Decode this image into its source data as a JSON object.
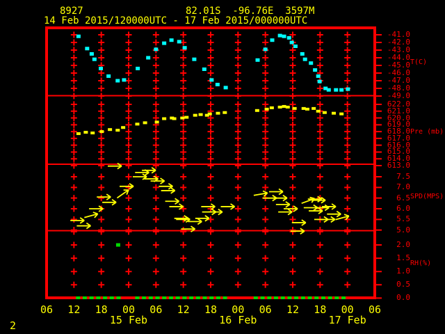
{
  "header": {
    "station_id": "8927",
    "location": "82.01S  -96.76E  3597M",
    "period": "14 Feb 2015/120000UTC - 17 Feb 2015/000000UTC"
  },
  "footer": {
    "page_number": "2"
  },
  "colors": {
    "background": "#000000",
    "grid": "#ff0000",
    "header_text": "#ffff00",
    "temperature": "#00ffff",
    "pressure": "#ffff00",
    "wind": "#ffff00",
    "humidity": "#00d900"
  },
  "chart_data": {
    "type": "scatter",
    "subtype": "multi-panel meteogram",
    "x_axis": {
      "tick_labels": [
        "06",
        "12",
        "18",
        "00",
        "06",
        "12",
        "18",
        "00",
        "06",
        "12",
        "18",
        "00",
        "06"
      ],
      "tick_hours": [
        0,
        6,
        12,
        18,
        24,
        30,
        36,
        42,
        48,
        54,
        60,
        66,
        72
      ],
      "hours_range": [
        0,
        72
      ],
      "date_labels": [
        {
          "label": "15 Feb",
          "hour": 18
        },
        {
          "label": "16 Feb",
          "hour": 42
        },
        {
          "label": "17 Feb",
          "hour": 66
        }
      ]
    },
    "panels": [
      {
        "name": "temperature",
        "ylabel": "T(C)",
        "yticks": [
          "-41.0",
          "-42.0",
          "-43.0",
          "-44.0",
          "-45.0",
          "-46.0",
          "-47.0",
          "-48.0",
          "-49.0"
        ],
        "ylim": [
          -49.0,
          -41.0
        ],
        "grid_rows": [
          -41,
          -42,
          -43,
          -44,
          -45,
          -46,
          -47,
          -48,
          -49
        ],
        "marker_color": "#00ffff",
        "points": [
          [
            7.0,
            -41.2
          ],
          [
            8.9,
            -42.8
          ],
          [
            9.9,
            -43.5
          ],
          [
            10.5,
            -44.2
          ],
          [
            11.9,
            -45.4
          ],
          [
            13.6,
            -46.4
          ],
          [
            15.6,
            -47.0
          ],
          [
            17.0,
            -46.9
          ],
          [
            20.0,
            -45.4
          ],
          [
            22.3,
            -44.0
          ],
          [
            24.0,
            -42.9
          ],
          [
            25.8,
            -42.1
          ],
          [
            27.4,
            -41.7
          ],
          [
            29.1,
            -41.9
          ],
          [
            30.3,
            -42.7
          ],
          [
            32.4,
            -44.2
          ],
          [
            34.6,
            -45.5
          ],
          [
            36.2,
            -46.9
          ],
          [
            37.5,
            -47.5
          ],
          [
            39.3,
            -47.9
          ],
          [
            46.3,
            -44.3
          ],
          [
            48.0,
            -42.9
          ],
          [
            49.5,
            -41.7
          ],
          [
            51.2,
            -41.1
          ],
          [
            52.1,
            -41.2
          ],
          [
            53.2,
            -41.4
          ],
          [
            53.8,
            -42.0
          ],
          [
            54.6,
            -42.5
          ],
          [
            56.1,
            -43.5
          ],
          [
            56.7,
            -44.2
          ],
          [
            58.0,
            -44.7
          ],
          [
            58.9,
            -45.6
          ],
          [
            59.6,
            -46.4
          ],
          [
            59.9,
            -47.1
          ],
          [
            61.2,
            -48.0
          ],
          [
            61.9,
            -48.2
          ],
          [
            63.5,
            -48.2
          ],
          [
            64.7,
            -48.2
          ],
          [
            66.1,
            -48.1
          ]
        ]
      },
      {
        "name": "pressure",
        "ylabel": "Pre (mb)",
        "yticks": [
          "622.0",
          "621.0",
          "620.0",
          "619.0",
          "618.0",
          "617.0",
          "616.0",
          "615.0",
          "614.0",
          "613.0"
        ],
        "ylim": [
          613.0,
          622.0
        ],
        "grid_rows": [
          622,
          621,
          620,
          619,
          618,
          617,
          616,
          615,
          614,
          613
        ],
        "marker_color": "#ffff00",
        "points": [
          [
            7.0,
            617.7
          ],
          [
            8.6,
            617.9
          ],
          [
            10.1,
            617.8
          ],
          [
            12.1,
            618.0
          ],
          [
            13.9,
            618.3
          ],
          [
            15.6,
            618.2
          ],
          [
            16.8,
            618.6
          ],
          [
            19.9,
            619.1
          ],
          [
            21.6,
            619.3
          ],
          [
            24.2,
            619.4
          ],
          [
            25.8,
            619.9
          ],
          [
            27.5,
            620.0
          ],
          [
            28.0,
            619.9
          ],
          [
            29.8,
            620.0
          ],
          [
            30.7,
            620.1
          ],
          [
            32.6,
            620.4
          ],
          [
            33.8,
            620.5
          ],
          [
            35.2,
            620.4
          ],
          [
            35.8,
            620.6
          ],
          [
            37.6,
            620.7
          ],
          [
            39.1,
            620.8
          ],
          [
            46.2,
            621.1
          ],
          [
            48.3,
            621.3
          ],
          [
            49.4,
            621.5
          ],
          [
            51.2,
            621.6
          ],
          [
            52.1,
            621.7
          ],
          [
            52.9,
            621.6
          ],
          [
            54.4,
            621.4
          ],
          [
            56.4,
            621.4
          ],
          [
            57.2,
            621.3
          ],
          [
            58.6,
            621.4
          ],
          [
            59.6,
            621.0
          ],
          [
            61.0,
            620.8
          ],
          [
            63.0,
            620.7
          ],
          [
            64.7,
            620.6
          ]
        ]
      },
      {
        "name": "wind_speed",
        "ylabel": "SPD(MPS)",
        "yticks": [
          "7.5",
          "7.0",
          "6.5",
          "6.0",
          "5.5",
          "5.0"
        ],
        "ylim": [
          5.0,
          7.5
        ],
        "grid_rows": [
          7.5,
          7.0,
          6.5,
          6.0,
          5.5,
          5.0
        ],
        "marker_color": "#ffff00",
        "barbs": [
          [
            7.2,
            5.45,
            0
          ],
          [
            8.6,
            5.2,
            0
          ],
          [
            10.2,
            5.7,
            -15
          ],
          [
            11.3,
            6.0,
            0
          ],
          [
            13.0,
            6.55,
            0
          ],
          [
            14.2,
            6.3,
            0
          ],
          [
            15.4,
            8.0,
            0
          ],
          [
            17.1,
            6.75,
            -35
          ],
          [
            18.0,
            7.05,
            0
          ],
          [
            20.9,
            7.5,
            0
          ],
          [
            21.4,
            7.7,
            0
          ],
          [
            22.9,
            7.8,
            0
          ],
          [
            23.4,
            7.4,
            0
          ],
          [
            24.8,
            7.3,
            0
          ],
          [
            26.6,
            7.05,
            0
          ],
          [
            27.1,
            6.85,
            0
          ],
          [
            28.0,
            6.35,
            0
          ],
          [
            28.9,
            6.1,
            0
          ],
          [
            30.0,
            5.55,
            0
          ],
          [
            30.4,
            5.5,
            0
          ],
          [
            31.5,
            5.05,
            0
          ],
          [
            33.0,
            5.4,
            0
          ],
          [
            34.6,
            5.55,
            0
          ],
          [
            35.9,
            6.1,
            0
          ],
          [
            36.1,
            5.85,
            0
          ],
          [
            37.5,
            5.85,
            0
          ],
          [
            40.2,
            6.1,
            0
          ],
          [
            47.4,
            6.7,
            -10
          ],
          [
            49.4,
            6.5,
            0
          ],
          [
            50.8,
            6.8,
            0
          ],
          [
            51.7,
            6.5,
            0
          ],
          [
            52.3,
            6.2,
            0
          ],
          [
            52.8,
            5.85,
            0
          ],
          [
            54.0,
            6.0,
            0
          ],
          [
            55.5,
            4.95,
            0
          ],
          [
            55.8,
            5.35,
            0
          ],
          [
            57.8,
            6.4,
            -20
          ],
          [
            58.4,
            6.05,
            0
          ],
          [
            59.3,
            6.45,
            0
          ],
          [
            59.5,
            5.9,
            0
          ],
          [
            60.1,
            6.4,
            0
          ],
          [
            60.7,
            5.5,
            0
          ],
          [
            60.9,
            6.05,
            0
          ],
          [
            62.2,
            5.5,
            0
          ],
          [
            62.4,
            6.1,
            0
          ],
          [
            63.5,
            5.75,
            0
          ],
          [
            65.3,
            5.6,
            -15
          ]
        ]
      },
      {
        "name": "relative_humidity",
        "ylabel": "RH(%)",
        "yticks": [
          "2.0",
          "1.5",
          "1.0",
          "0.5",
          "0.0"
        ],
        "ylim": [
          0.0,
          2.0
        ],
        "grid_rows": [
          2.5,
          2.0,
          1.5,
          1.0,
          0.5
        ],
        "marker_color": "#00d900",
        "points": [
          [
            15.7,
            2.0
          ]
        ],
        "baseline_value": 0.0,
        "baseline_segments": [
          [
            6.9,
            17.1
          ],
          [
            19.9,
            40.4
          ],
          [
            45.9,
            65.3
          ]
        ],
        "baseline_dash_step_hours": 1.48
      }
    ]
  }
}
